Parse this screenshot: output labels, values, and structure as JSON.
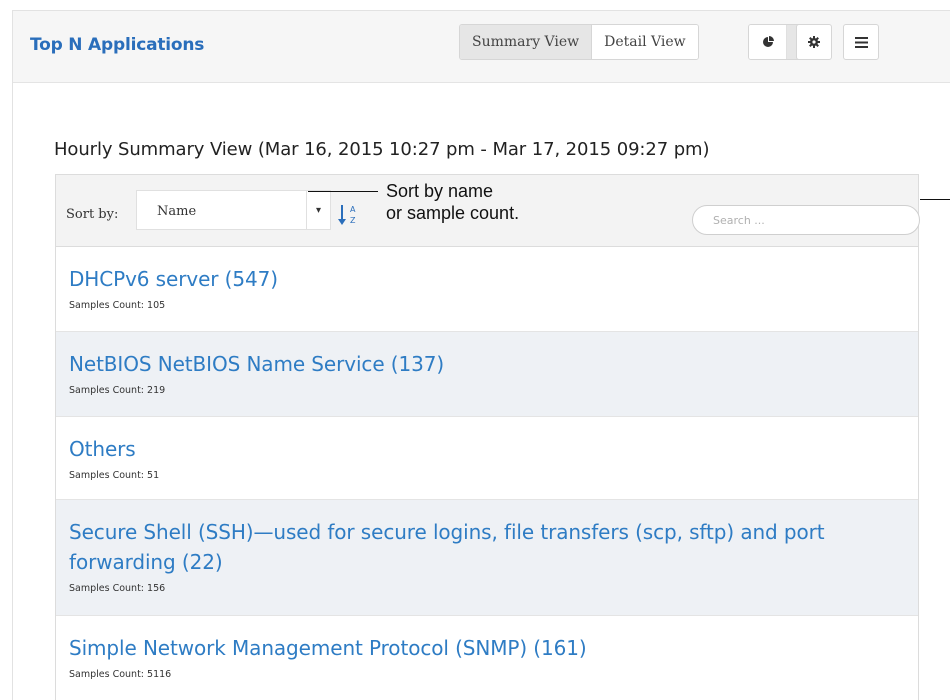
{
  "panel": {
    "title": "Top N Applications",
    "view_tabs": [
      {
        "label": "Summary View",
        "active": true
      },
      {
        "label": "Detail View",
        "active": false
      }
    ],
    "toolbar_icons": [
      "pie-chart-icon",
      "list-icon",
      "gear-icon",
      "menu-icon"
    ]
  },
  "summary": {
    "heading": "Hourly Summary View (Mar 16, 2015 10:27 pm - Mar 17, 2015 09:27 pm)"
  },
  "toolbar": {
    "sort_label": "Sort by:",
    "sort_value": "Name",
    "sort_caret": "▾",
    "search_placeholder": "Search ...",
    "callout_line1": "Sort by name",
    "callout_line2": "or sample count."
  },
  "applications": [
    {
      "name": "DHCPv6 server (547)",
      "samples": "Samples Count: 105"
    },
    {
      "name": "NetBIOS NetBIOS Name Service (137)",
      "samples": "Samples Count: 219"
    },
    {
      "name": "Others",
      "samples": "Samples Count: 51"
    },
    {
      "name": "Secure Shell (SSH)—used for secure logins, file transfers (scp, sftp) and port forwarding (22)",
      "samples": "Samples Count: 156"
    },
    {
      "name": "Simple Network Management Protocol (SNMP) (161)",
      "samples": "Samples Count: 5116"
    }
  ],
  "colors": {
    "title_blue": "#2a6ebb",
    "link_blue": "#2e7cc4",
    "alt_row": "#eef1f5",
    "header_bg": "#f6f6f6"
  }
}
